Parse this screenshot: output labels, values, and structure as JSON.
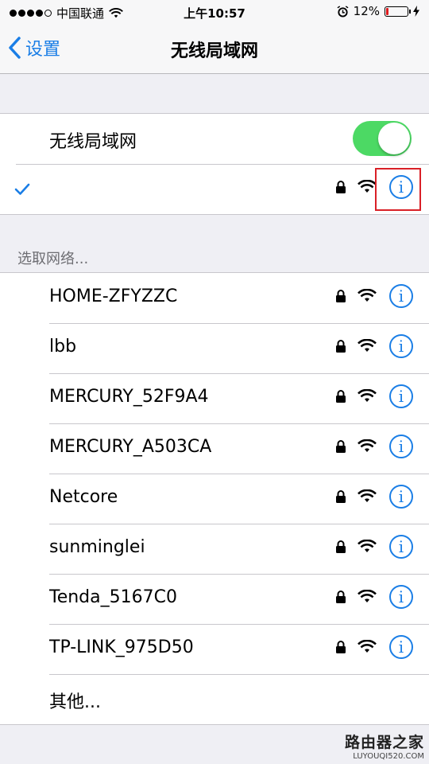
{
  "status_bar": {
    "carrier": "中国联通",
    "time": "上午10:57",
    "battery_percent": "12%",
    "battery_level": 0.12
  },
  "nav": {
    "back_label": "设置",
    "title": "无线局域网"
  },
  "wifi_toggle": {
    "label": "无线局域网",
    "on": true,
    "color": "#4cd964"
  },
  "connected_network": {
    "name": "",
    "locked": true,
    "signal": "full"
  },
  "section_header": "选取网络...",
  "networks": [
    {
      "name": "HOME-ZFYZZC",
      "locked": true
    },
    {
      "name": "lbb",
      "locked": true
    },
    {
      "name": "MERCURY_52F9A4",
      "locked": true
    },
    {
      "name": "MERCURY_A503CA",
      "locked": true
    },
    {
      "name": "Netcore",
      "locked": true
    },
    {
      "name": "sunminglei",
      "locked": true
    },
    {
      "name": "Tenda_5167C0",
      "locked": true
    },
    {
      "name": "TP-LINK_975D50",
      "locked": true
    }
  ],
  "other_label": "其他...",
  "info_glyph": "i",
  "watermark": {
    "line1": "路由器之家",
    "line2": "LUYOUQI520.COM"
  },
  "colors": {
    "accent": "#1a7ee6",
    "highlight": "#d92027",
    "battery_low": "#e0191c"
  }
}
